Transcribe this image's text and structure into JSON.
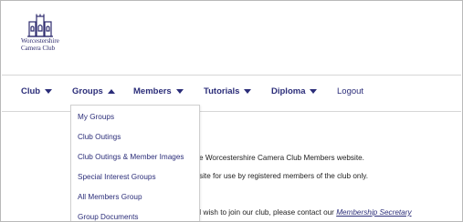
{
  "logo": {
    "line1": "Worcestershire",
    "line2": "Camera Club"
  },
  "nav": {
    "items": [
      {
        "label": "Club",
        "caret": "down"
      },
      {
        "label": "Groups",
        "caret": "up"
      },
      {
        "label": "Members",
        "caret": "down"
      },
      {
        "label": "Tutorials",
        "caret": "down"
      },
      {
        "label": "Diploma",
        "caret": "down"
      }
    ],
    "logout": "Logout"
  },
  "dropdown": {
    "items": [
      "My Groups",
      "Club Outings",
      "Club Outings & Member Images",
      "Special Interest Groups",
      "All Members Group",
      "Group Documents"
    ]
  },
  "content": {
    "line1": "e Worcestershire Camera Club Members website.",
    "line2": "site for use by registered members of the club only.",
    "line3_prefix": "I wish to join our club, please contact our ",
    "line3_link": "Membership Secretary"
  },
  "colors": {
    "nav": "#2b2d79",
    "logo": "#2e2b6e"
  }
}
